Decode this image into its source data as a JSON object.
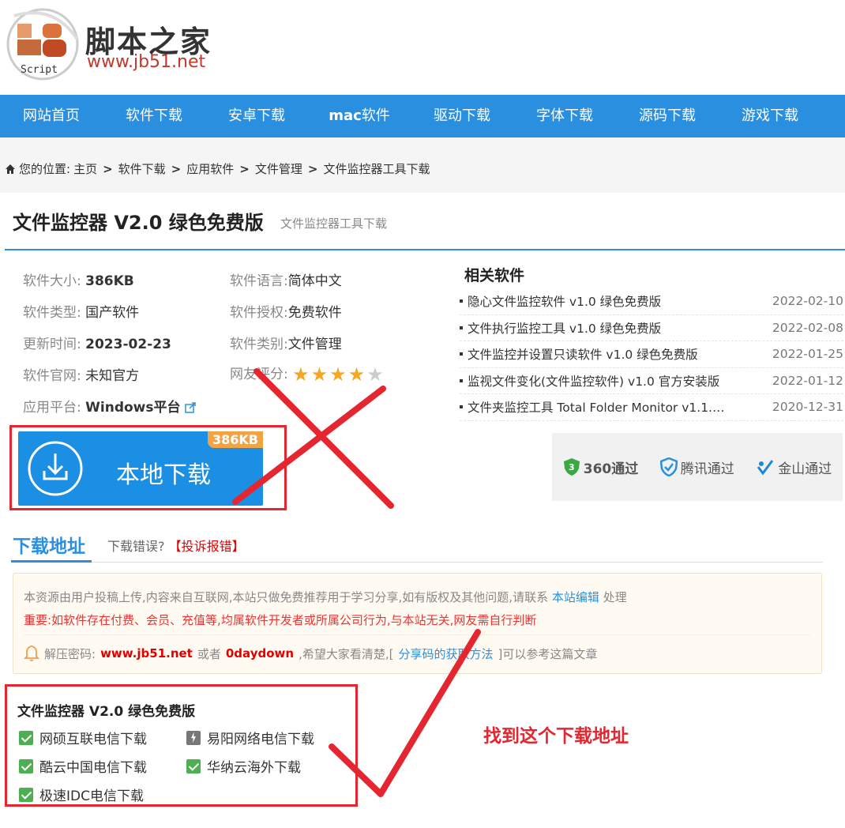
{
  "header": {
    "site_name": "脚本之家",
    "site_url": "www.jb51.net",
    "logo_sub": "Script"
  },
  "nav": [
    {
      "label": "网站首页"
    },
    {
      "label": "软件下载"
    },
    {
      "label": "安卓下载"
    },
    {
      "label_bold": "mac",
      "label": "软件"
    },
    {
      "label": "驱动下载"
    },
    {
      "label": "字体下载"
    },
    {
      "label": "源码下载"
    },
    {
      "label": "游戏下载"
    }
  ],
  "breadcrumb": {
    "prefix": "您的位置:",
    "items": [
      "主页",
      "软件下载",
      "应用软件",
      "文件管理",
      "文件监控器工具下载"
    ]
  },
  "title": {
    "main": "文件监控器 V2.0 绿色免费版",
    "sub": "文件监控器工具下载"
  },
  "info": {
    "size_label": "软件大小:",
    "size": "386KB",
    "lang_label": "软件语言:",
    "lang": "简体中文",
    "type_label": "软件类型:",
    "type": "国产软件",
    "license_label": "软件授权:",
    "license": "免费软件",
    "update_label": "更新时间:",
    "update": "2023-02-23",
    "category_label": "软件类别:",
    "category": "文件管理",
    "official_label": "软件官网:",
    "official": "未知官方",
    "rating_label": "网友评分:",
    "rating": 4,
    "rating_max": 5,
    "platform_label": "应用平台:",
    "platform": "Windows平台"
  },
  "related": {
    "title": "相关软件",
    "items": [
      {
        "name": "隐心文件监控软件 v1.0 绿色免费版",
        "date": "2022-02-10"
      },
      {
        "name": "文件执行监控工具 v1.0 绿色免费版",
        "date": "2022-02-08"
      },
      {
        "name": "文件监控并设置只读软件 v1.0 绿色免费版",
        "date": "2022-01-25"
      },
      {
        "name": "监视文件变化(文件监控软件) v1.0 官方安装版",
        "date": "2022-01-12"
      },
      {
        "name": "文件夹监控工具 Total Folder Monitor v1.1.…",
        "date": "2020-12-31"
      }
    ]
  },
  "safe": {
    "s360": "360通过",
    "tencent": "腾讯通过",
    "kingsoft": "金山通过"
  },
  "download_btn": {
    "label": "本地下载",
    "size": "386KB"
  },
  "download_section": {
    "tab": "下载地址",
    "error_text": "下载错误?",
    "report": "【投诉报错】",
    "notice1": "本资源由用户投稿上传,内容来自互联网,本站只做免费推荐用于学习分享,如有版权及其他问题,请联系",
    "notice1_link": "本站编辑",
    "notice1_end": "处理",
    "notice2": "重要:如软件存在付费、会员、充值等,均属软件开发者或所属公司行为,与本站无关,网友需自行判断",
    "pwd_label": "解压密码:",
    "pwd1": "www.jb51.net",
    "pwd_or": "或者",
    "pwd2": "0daydown",
    "pwd_tail": ",希望大家看清楚,[",
    "pwd_link": "分享码的获取方法",
    "pwd_end": "]可以参考这篇文章"
  },
  "mirrors": {
    "title": "文件监控器 V2.0 绿色免费版",
    "items": [
      {
        "label": "网硕互联电信下载",
        "icon": "check"
      },
      {
        "label": "易阳网络电信下载",
        "icon": "bolt"
      },
      {
        "label": "酷云中国电信下载",
        "icon": "check"
      },
      {
        "label": "华纳云海外下载",
        "icon": "check"
      },
      {
        "label": "极速IDC电信下载",
        "icon": "check"
      }
    ]
  },
  "annotation": "找到这个下载地址",
  "colors": {
    "nav_bg": "#2b8fe0",
    "annotation_red": "#e32630",
    "star": "#f5a623"
  }
}
